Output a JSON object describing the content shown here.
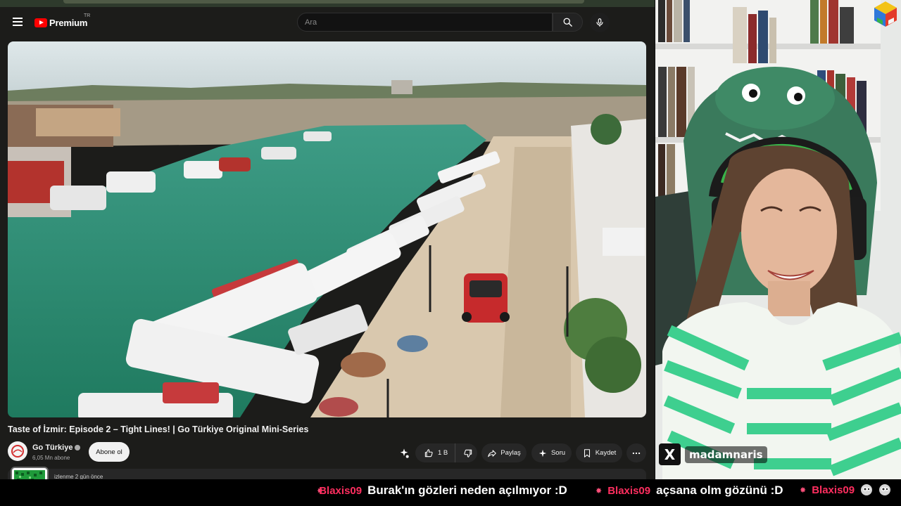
{
  "app": {
    "logo_text": "Premium",
    "logo_region": "TR"
  },
  "search": {
    "placeholder": "Ara"
  },
  "video": {
    "title": "Taste of İzmir: Episode 2 – Tight Lines! | Go Türkiye Original Mini-Series",
    "channel_name": "Go Türkiye",
    "subscribers": "6,05 Mn abone",
    "subscribe_label": "Abone ol",
    "like_count": "1 B",
    "share_label": "Paylaş",
    "ask_label": "Soru",
    "save_label": "Kaydet",
    "meta_text": "izlenme 2 gün önce"
  },
  "stream": {
    "x_symbol": "X",
    "x_handle": "madamnaris"
  },
  "chat_ticker": [
    {
      "user": "",
      "message": "Burak'ın gözleri neden açılmıyor :D"
    },
    {
      "user": "Blaxis09",
      "message": "açsana olm gözünü :D"
    },
    {
      "user": "Blaxis09",
      "message": ""
    }
  ],
  "colors": {
    "youtube_red": "#ff0000",
    "chat_username": "#ff2e5f",
    "surface": "#272727"
  },
  "icons": [
    "menu-icon",
    "youtube-logo",
    "search-icon",
    "mic-icon",
    "verified-icon",
    "thumb-up-icon",
    "thumb-down-icon",
    "share-icon",
    "sparkle-icon",
    "bookmark-icon",
    "more-icon",
    "x-logo-icon",
    "star-icon",
    "emoji-icon"
  ]
}
